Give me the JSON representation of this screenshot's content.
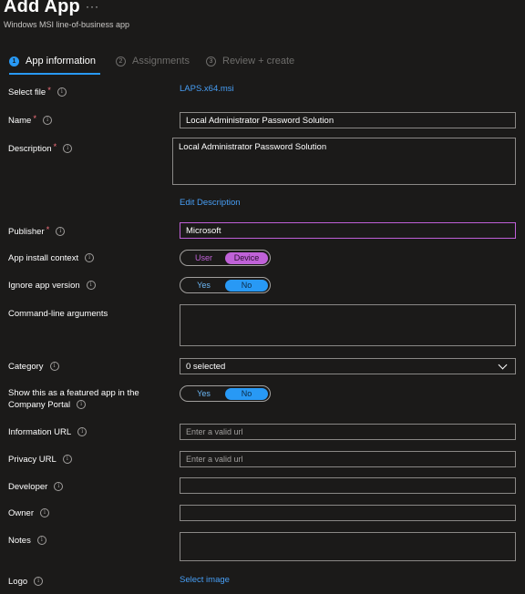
{
  "header": {
    "title": "Add App",
    "more_label": "···",
    "subtitle": "Windows MSI line-of-business app"
  },
  "steps": [
    {
      "num": "1",
      "label": "App information",
      "active": true
    },
    {
      "num": "2",
      "label": "Assignments",
      "active": false
    },
    {
      "num": "3",
      "label": "Review + create",
      "active": false
    }
  ],
  "form": {
    "select_file": {
      "label": "Select file",
      "value": "LAPS.x64.msi"
    },
    "name": {
      "label": "Name",
      "value": "Local Administrator Password Solution"
    },
    "description": {
      "label": "Description",
      "value": "Local Administrator Password Solution",
      "edit_link": "Edit Description"
    },
    "publisher": {
      "label": "Publisher",
      "value": "Microsoft"
    },
    "install_context": {
      "label": "App install context",
      "options": [
        "User",
        "Device"
      ],
      "selected": "Device"
    },
    "ignore_version": {
      "label": "Ignore app version",
      "options": [
        "Yes",
        "No"
      ],
      "selected": "No"
    },
    "command_line": {
      "label": "Command-line arguments",
      "value": ""
    },
    "category": {
      "label": "Category",
      "value": "0 selected"
    },
    "featured": {
      "label": "Show this as a featured app in the Company Portal",
      "options": [
        "Yes",
        "No"
      ],
      "selected": "No"
    },
    "information_url": {
      "label": "Information URL",
      "placeholder": "Enter a valid url"
    },
    "privacy_url": {
      "label": "Privacy URL",
      "placeholder": "Enter a valid url"
    },
    "developer": {
      "label": "Developer",
      "value": ""
    },
    "owner": {
      "label": "Owner",
      "value": ""
    },
    "notes": {
      "label": "Notes",
      "value": ""
    },
    "logo": {
      "label": "Logo",
      "link": "Select image"
    }
  },
  "icons": {
    "info": "info-circle-icon",
    "required": "asterisk",
    "chevron": "chevron-down-icon"
  },
  "colors": {
    "accent": "#2899f5",
    "purple_accent": "#c062d8",
    "link": "#479ef5",
    "required": "#f1707b",
    "background": "#1b1a19"
  }
}
